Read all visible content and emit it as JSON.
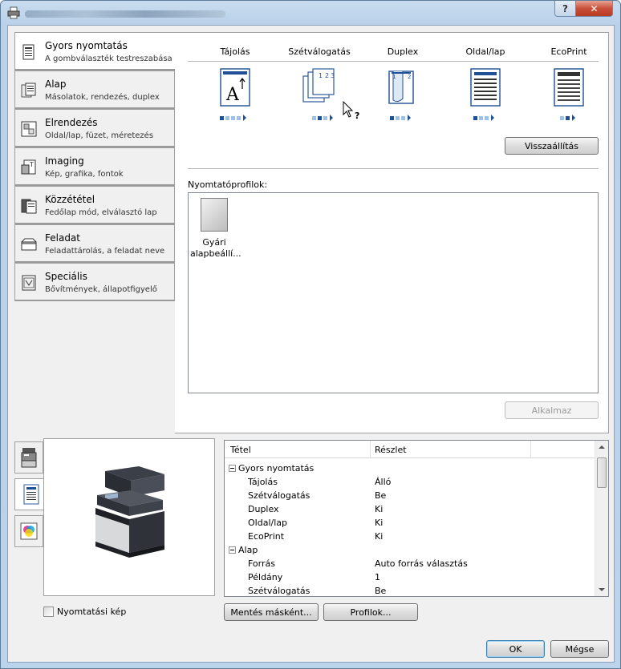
{
  "window": {
    "title": ""
  },
  "titlebar": {
    "help_label": "?",
    "close_label": "✕"
  },
  "nav": {
    "items": [
      {
        "title": "Gyors nyomtatás",
        "subtitle": "A gombválaszték testreszabása",
        "icon": "quick-print-icon",
        "active": true
      },
      {
        "title": "Alap",
        "subtitle": "Másolatok, rendezés, duplex",
        "icon": "basic-icon"
      },
      {
        "title": "Elrendezés",
        "subtitle": "Oldal/lap, füzet, méretezés",
        "icon": "layout-icon"
      },
      {
        "title": "Imaging",
        "subtitle": "Kép, grafika, fontok",
        "icon": "imaging-icon"
      },
      {
        "title": "Közzététel",
        "subtitle": "Fedőlap mód, elválasztó lap",
        "icon": "publishing-icon"
      },
      {
        "title": "Feladat",
        "subtitle": "Feladattárolás, a feladat neve",
        "icon": "job-icon"
      },
      {
        "title": "Speciális",
        "subtitle": "Bővítmények, állapotfigyelő",
        "icon": "advanced-icon"
      }
    ]
  },
  "quick_options": {
    "labels": [
      "Tájolás",
      "Szétválogatás",
      "Duplex",
      "Oldal/lap",
      "EcoPrint"
    ],
    "reset_label": "Visszaállítás"
  },
  "profiles": {
    "label": "Nyomtatóprofilok:",
    "items": [
      {
        "name": "Gyári alapbeállí..."
      }
    ],
    "apply_label": "Alkalmaz"
  },
  "details": {
    "col_item": "Tétel",
    "col_detail": "Részlet",
    "rows": [
      {
        "key": "Gyors nyomtatás",
        "value": "",
        "group": true
      },
      {
        "key": "Tájolás",
        "value": "Álló"
      },
      {
        "key": "Szétválogatás",
        "value": "Be"
      },
      {
        "key": "Duplex",
        "value": "Ki"
      },
      {
        "key": "Oldal/lap",
        "value": "Ki"
      },
      {
        "key": "EcoPrint",
        "value": "Ki"
      },
      {
        "key": "Alap",
        "value": "",
        "group": true
      },
      {
        "key": "Forrás",
        "value": "Auto forrás választás"
      },
      {
        "key": "Példány",
        "value": "1"
      },
      {
        "key": "Szétválogatás",
        "value": "Be"
      }
    ]
  },
  "bottom": {
    "print_preview_label": "Nyomtatási kép",
    "save_as_label": "Mentés másként...",
    "profiles_label": "Profilok...",
    "ok_label": "OK",
    "cancel_label": "Mégse"
  }
}
